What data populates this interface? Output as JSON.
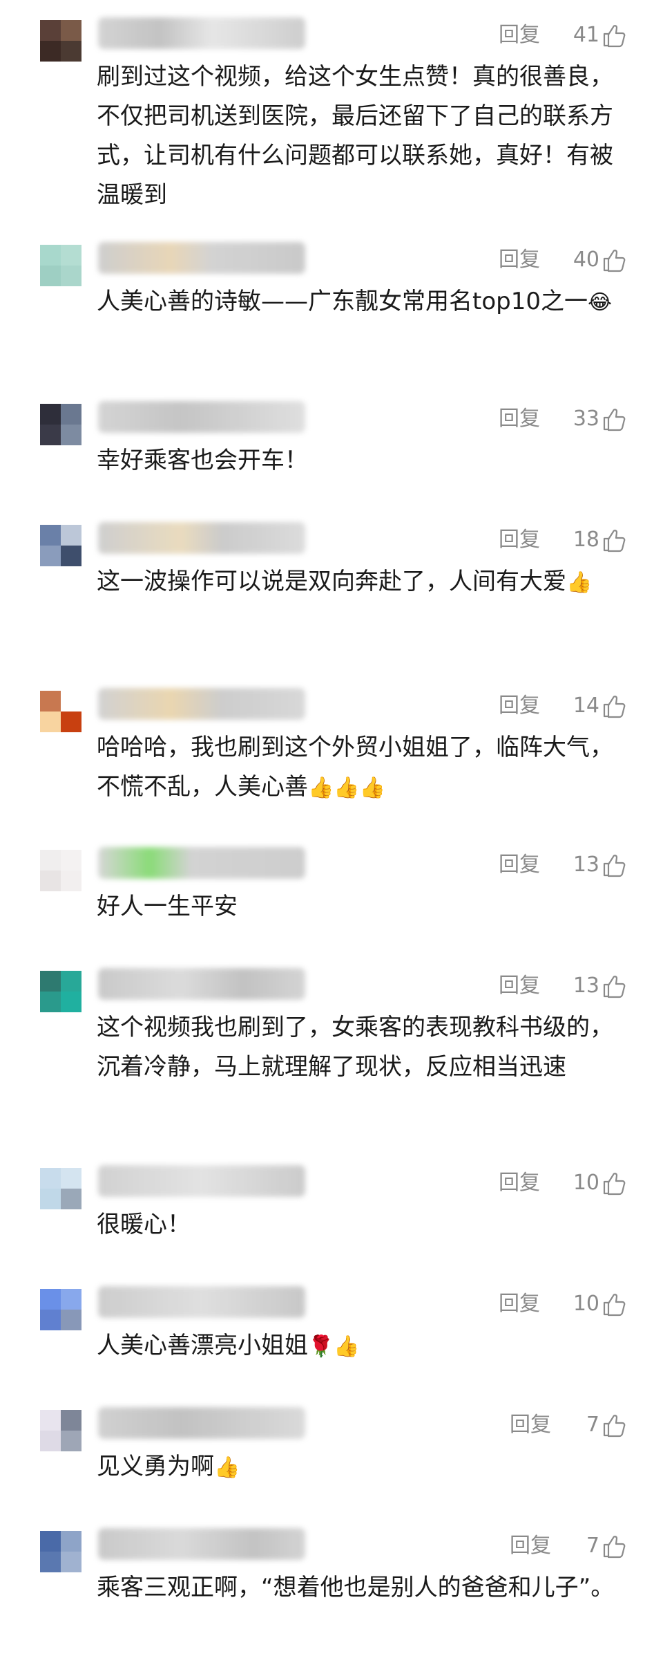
{
  "reply_label": "回复",
  "colors": {
    "text": "#1a1a1a",
    "meta": "#8a8a8a",
    "background": "#ffffff"
  },
  "comments": [
    {
      "likes": "41",
      "text": "刷到过这个视频，给这个女生点赞！真的很善良，不仅把司机送到医院，最后还留下了自己的联系方式，让司机有什么问题都可以联系她，真好！有被温暖到",
      "emoji": ""
    },
    {
      "likes": "40",
      "text": "人美心善的诗敏——广东靓女常用名top10之一",
      "emoji": "😂"
    },
    {
      "likes": "33",
      "text": "幸好乘客也会开车！",
      "emoji": ""
    },
    {
      "likes": "18",
      "text": "这一波操作可以说是双向奔赴了，人间有大爱",
      "emoji": "👍"
    },
    {
      "likes": "14",
      "text": "哈哈哈，我也刷到这个外贸小姐姐了，临阵大气，不慌不乱，人美心善",
      "emoji": "👍👍👍"
    },
    {
      "likes": "13",
      "text": "好人一生平安",
      "emoji": ""
    },
    {
      "likes": "13",
      "text": "这个视频我也刷到了，女乘客的表现教科书级的，沉着冷静，马上就理解了现状，反应相当迅速",
      "emoji": ""
    },
    {
      "likes": "10",
      "text": "很暖心！",
      "emoji": ""
    },
    {
      "likes": "10",
      "text": "人美心善漂亮小姐姐",
      "emoji": "🌹👍"
    },
    {
      "likes": "7",
      "text": "见义勇为啊",
      "emoji": "👍"
    },
    {
      "likes": "7",
      "text": "乘客三观正啊，“想着他也是别人的爸爸和儿子”。",
      "emoji": ""
    }
  ]
}
